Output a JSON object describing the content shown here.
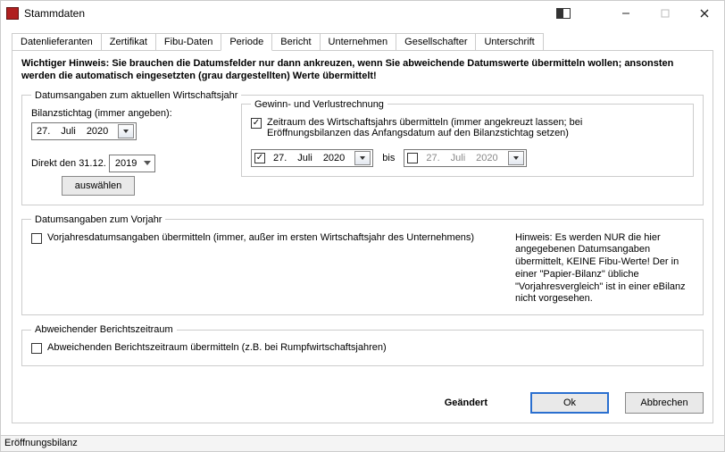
{
  "window": {
    "title": "Stammdaten"
  },
  "tabs": [
    "Datenlieferanten",
    "Zertifikat",
    "Fibu-Daten",
    "Periode",
    "Bericht",
    "Unternehmen",
    "Gesellschafter",
    "Unterschrift"
  ],
  "active_tab": "Periode",
  "hint": "Wichtiger Hinweis: Sie brauchen die Datumsfelder nur dann ankreuzen, wenn Sie abweichende Datumswerte übermitteln wollen; ansonsten werden die automatisch eingesetzten (grau dargestellten) Werte übermittelt!",
  "group_current": {
    "legend": "Datumsangaben zum aktuellen Wirtschaftsjahr",
    "bilanz_label": "Bilanzstichtag (immer angeben):",
    "bilanz_date": {
      "day": "27.",
      "month": "Juli",
      "year": "2020"
    },
    "direct_label": "Direkt den 31.12.",
    "direct_year": "2019",
    "direct_button": "auswählen",
    "gw": {
      "legend": "Gewinn- und Verlustrechnung",
      "zeitraum_checked": true,
      "zeitraum_label": "Zeitraum des Wirtschaftsjahrs übermitteln (immer angekreuzt lassen; bei Eröffnungsbilanzen das Anfangsdatum auf den Bilanzstichtag setzen)",
      "from": {
        "checked": true,
        "day": "27.",
        "month": "Juli",
        "year": "2020"
      },
      "bis_label": "bis",
      "to": {
        "checked": false,
        "day": "27.",
        "month": "Juli",
        "year": "2020"
      }
    }
  },
  "group_prev": {
    "legend": "Datumsangaben zum Vorjahr",
    "check_label": "Vorjahresdatumsangaben übermitteln (immer, außer im ersten Wirtschaftsjahr des Unternehmens)",
    "check_checked": false,
    "note": "Hinweis: Es werden NUR die hier angegebenen Datumsangaben übermittelt, KEINE Fibu-Werte! Der in einer \"Papier-Bilanz\" übliche \"Vorjahresvergleich\" ist in einer eBilanz nicht vorgesehen."
  },
  "group_report": {
    "legend": "Abweichender Berichtszeitraum",
    "check_label": "Abweichenden Berichtszeitraum übermitteln (z.B. bei Rumpfwirtschaftsjahren)",
    "check_checked": false
  },
  "footer": {
    "changed": "Geändert",
    "ok": "Ok",
    "cancel": "Abbrechen"
  },
  "statusbar": "Eröffnungsbilanz"
}
